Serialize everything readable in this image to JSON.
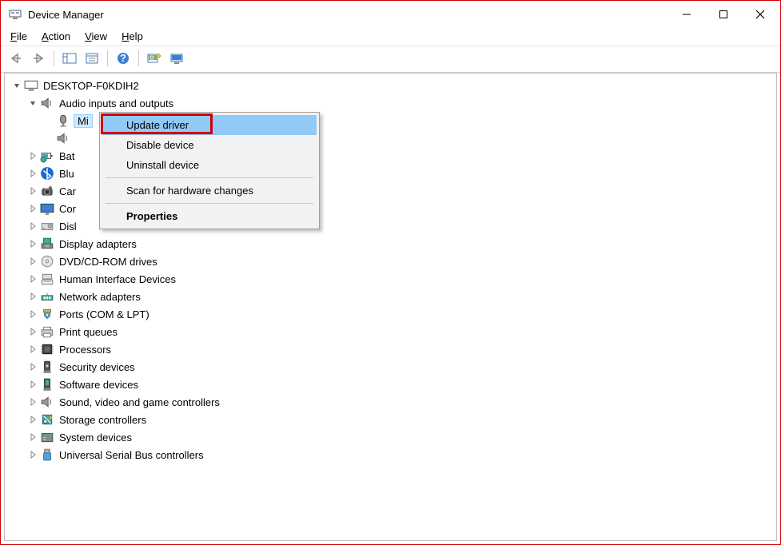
{
  "window": {
    "title": "Device Manager"
  },
  "menu": {
    "file": "File",
    "action": "Action",
    "view": "View",
    "help": "Help"
  },
  "tree": {
    "root": "DESKTOP-F0KDIH2",
    "audio_category": "Audio inputs and outputs",
    "audio_child1": "Mi",
    "audio_child2": "",
    "categories": [
      "Bat",
      "Blu",
      "Car",
      "Cor",
      "Disl",
      "Display adapters",
      "DVD/CD-ROM drives",
      "Human Interface Devices",
      "Network adapters",
      "Ports (COM & LPT)",
      "Print queues",
      "Processors",
      "Security devices",
      "Software devices",
      "Sound, video and game controllers",
      "Storage controllers",
      "System devices",
      "Universal Serial Bus controllers"
    ]
  },
  "context_menu": {
    "update_driver": "Update driver",
    "disable_device": "Disable device",
    "uninstall_device": "Uninstall device",
    "scan": "Scan for hardware changes",
    "properties": "Properties"
  },
  "category_icons": [
    "battery",
    "bluetooth",
    "camera",
    "monitor",
    "disk",
    "display",
    "dvd",
    "hid",
    "network",
    "port",
    "printer",
    "processor",
    "security",
    "software",
    "sound",
    "storage",
    "system",
    "usb"
  ]
}
